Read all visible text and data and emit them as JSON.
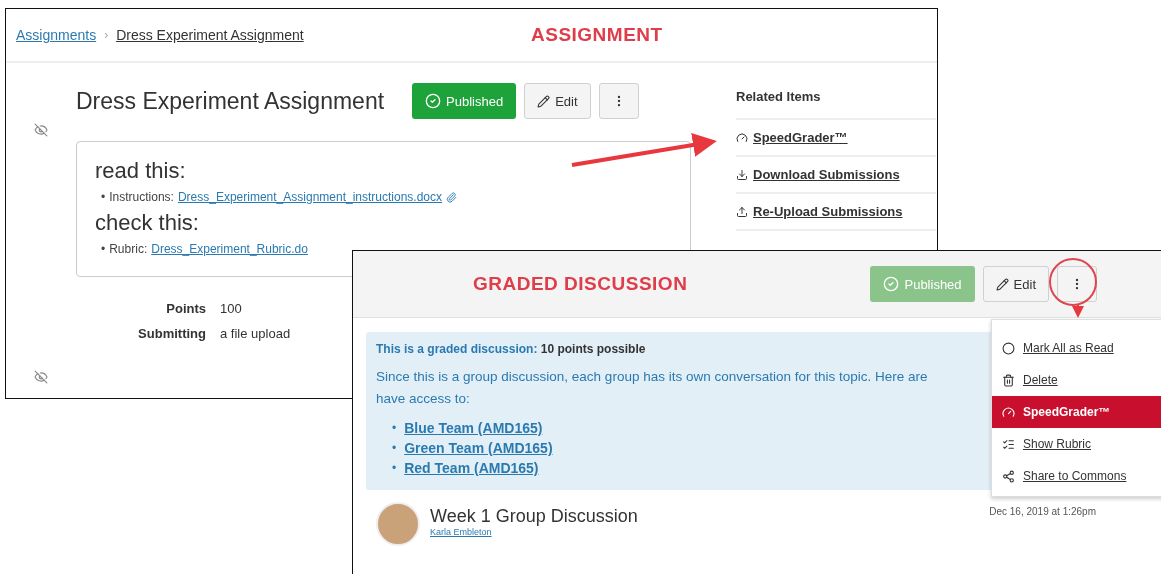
{
  "assignment": {
    "annotation_label": "ASSIGNMENT",
    "breadcrumbs": [
      {
        "label": "Assignments",
        "kind": "link"
      },
      {
        "label": "Dress Experiment Assignment",
        "kind": "current"
      }
    ],
    "breadcrumb_separator": "›",
    "title": "Dress Experiment Assignment",
    "buttons": [
      {
        "kind": "published",
        "label": "Published"
      },
      {
        "kind": "edit",
        "label": "Edit"
      },
      {
        "kind": "more"
      }
    ],
    "content": [
      {
        "kind": "heading",
        "text": "read this:"
      },
      {
        "kind": "item",
        "bullet": "•",
        "label": "Instructions:",
        "link": "Dress_Experiment_Assignment_instructions.docx",
        "attachment": true
      },
      {
        "kind": "heading",
        "text": "check this:"
      },
      {
        "kind": "item",
        "bullet": "•",
        "label": "Rubric:",
        "link": "Dress_Experiment_Rubric.do",
        "attachment": false
      }
    ],
    "details": [
      {
        "label": "Points",
        "value": "100"
      },
      {
        "label": "Submitting",
        "value": "a file upload"
      }
    ],
    "related_items": {
      "title": "Related Items",
      "items": [
        {
          "kind": "speedgrader",
          "label": "SpeedGrader™"
        },
        {
          "kind": "download",
          "label": "Download Submissions"
        },
        {
          "kind": "upload",
          "label": "Re-Upload Submissions"
        }
      ]
    }
  },
  "discussion": {
    "annotation_label": "GRADED DISCUSSION",
    "buttons": [
      {
        "kind": "published",
        "label": "Published"
      },
      {
        "kind": "edit",
        "label": "Edit"
      },
      {
        "kind": "more"
      }
    ],
    "notice": {
      "label": "This is a graded discussion:",
      "value": "10 points possible"
    },
    "intro_lines": [
      "Since this is a group discussion, each group has its own conversation for this topic. Here are",
      "have access to:"
    ],
    "groups": [
      {
        "bullet": "•",
        "label": "Blue Team (AMD165)"
      },
      {
        "bullet": "•",
        "label": "Green Team (AMD165)"
      },
      {
        "bullet": "•",
        "label": "Red Team (AMD165)"
      }
    ],
    "menu": [
      {
        "kind": "mark-read",
        "label": "Mark All as Read",
        "selected": false
      },
      {
        "kind": "delete",
        "label": "Delete",
        "selected": false
      },
      {
        "kind": "speedgrader",
        "label": "SpeedGrader™",
        "selected": true
      },
      {
        "kind": "rubric",
        "label": "Show Rubric",
        "selected": false
      },
      {
        "kind": "share",
        "label": "Share to Commons",
        "selected": false
      }
    ],
    "topic": {
      "title": "Week 1 Group Discussion",
      "author": "Karla Embleton",
      "date": "Dec 16, 2019 at 1:26pm"
    }
  }
}
